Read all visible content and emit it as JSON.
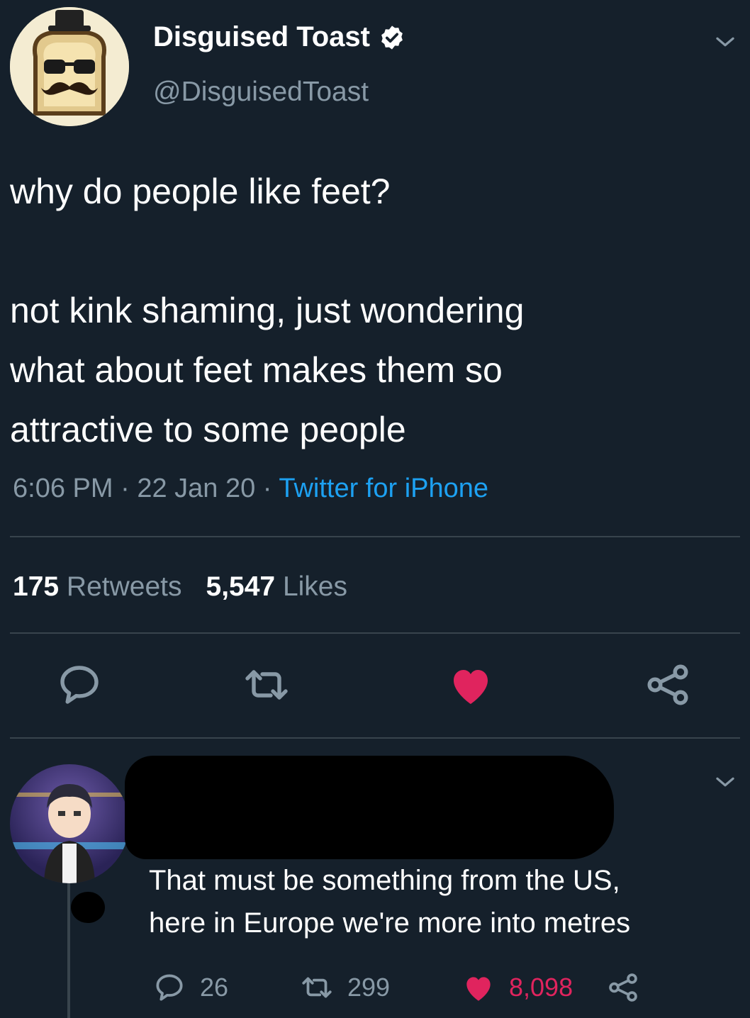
{
  "tweet": {
    "author": {
      "display_name": "Disguised Toast",
      "verified": true,
      "handle": "@DisguisedToast"
    },
    "text": {
      "line1": "why do people like feet?",
      "line2": "not kink shaming, just wondering",
      "line3": "what about feet makes them so",
      "line4": "attractive to some people"
    },
    "time": "6:06 PM",
    "separator": "·",
    "date": "22 Jan 20",
    "source": "Twitter for iPhone",
    "stats": {
      "retweets_count": "175",
      "retweets_label": "Retweets",
      "likes_count": "5,547",
      "likes_label": "Likes"
    },
    "liked": true
  },
  "reply": {
    "author_redacted": true,
    "text": {
      "line1": "That must be something from the US,",
      "line2": "here in Europe we're more into metres"
    },
    "reply_count": "26",
    "retweet_count": "299",
    "like_count": "8,098",
    "liked": true
  },
  "icons": {
    "reply": "speech-bubble-icon",
    "retweet": "retweet-icon",
    "like": "heart-icon",
    "share": "share-icon",
    "verified": "verified-badge-icon",
    "menu": "chevron-down-icon"
  },
  "colors": {
    "background": "#15202b",
    "secondary_text": "#8899a6",
    "link": "#1da1f2",
    "like": "#e0245e",
    "divider": "#38444d"
  }
}
